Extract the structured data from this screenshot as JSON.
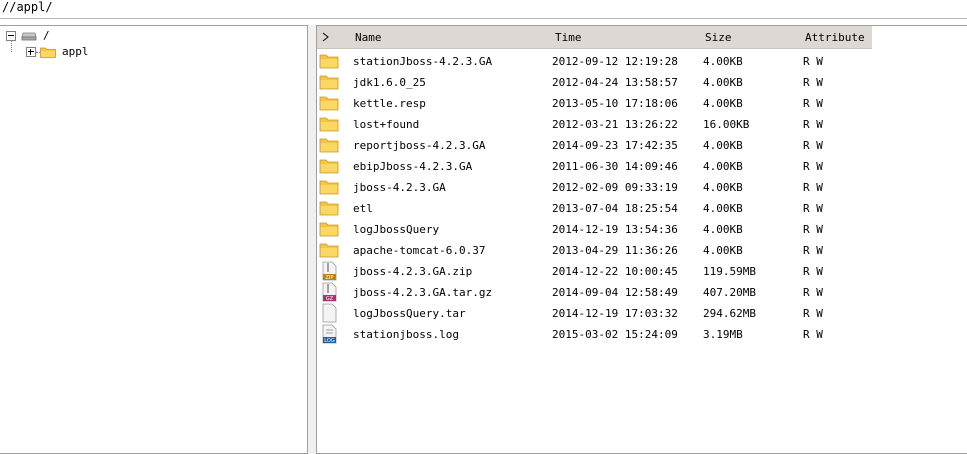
{
  "path": "//appl/",
  "tree": {
    "root_label": "/",
    "child_label": "appl"
  },
  "columns": {
    "name": "Name",
    "time": "Time",
    "size": "Size",
    "attribute": "Attribute"
  },
  "files": [
    {
      "name": "stationJboss-4.2.3.GA",
      "time": "2012-09-12 12:19:28",
      "size": "4.00KB",
      "attr": "R W",
      "icon": "folder-icon"
    },
    {
      "name": "jdk1.6.0_25",
      "time": "2012-04-24 13:58:57",
      "size": "4.00KB",
      "attr": "R W",
      "icon": "folder-icon"
    },
    {
      "name": "kettle.resp",
      "time": "2013-05-10 17:18:06",
      "size": "4.00KB",
      "attr": "R W",
      "icon": "folder-icon"
    },
    {
      "name": "lost+found",
      "time": "2012-03-21 13:26:22",
      "size": "16.00KB",
      "attr": "R W",
      "icon": "folder-icon"
    },
    {
      "name": "reportjboss-4.2.3.GA",
      "time": "2014-09-23 17:42:35",
      "size": "4.00KB",
      "attr": "R W",
      "icon": "folder-icon"
    },
    {
      "name": "ebipJboss-4.2.3.GA",
      "time": "2011-06-30 14:09:46",
      "size": "4.00KB",
      "attr": "R W",
      "icon": "folder-icon"
    },
    {
      "name": "jboss-4.2.3.GA",
      "time": "2012-02-09 09:33:19",
      "size": "4.00KB",
      "attr": "R W",
      "icon": "folder-icon"
    },
    {
      "name": "etl",
      "time": "2013-07-04 18:25:54",
      "size": "4.00KB",
      "attr": "R W",
      "icon": "folder-icon"
    },
    {
      "name": "logJbossQuery",
      "time": "2014-12-19 13:54:36",
      "size": "4.00KB",
      "attr": "R W",
      "icon": "folder-icon"
    },
    {
      "name": "apache-tomcat-6.0.37",
      "time": "2013-04-29 11:36:26",
      "size": "4.00KB",
      "attr": "R W",
      "icon": "folder-icon"
    },
    {
      "name": "jboss-4.2.3.GA.zip",
      "time": "2014-12-22 10:00:45",
      "size": "119.59MB",
      "attr": "R W",
      "icon": "zip-file-icon",
      "badge": "ZIP"
    },
    {
      "name": "jboss-4.2.3.GA.tar.gz",
      "time": "2014-09-04 12:58:49",
      "size": "407.20MB",
      "attr": "R W",
      "icon": "gz-file-icon",
      "badge": "GZ"
    },
    {
      "name": "logJbossQuery.tar",
      "time": "2014-12-19 17:03:32",
      "size": "294.62MB",
      "attr": "R W",
      "icon": "blank-file-icon"
    },
    {
      "name": "stationjboss.log",
      "time": "2015-03-02 15:24:09",
      "size": "3.19MB",
      "attr": "R W",
      "icon": "log-file-icon",
      "badge": "LOG"
    }
  ],
  "colors": {
    "header_bg": "#ddd8d3",
    "folder": "#f4c542",
    "zip_badge": "#b8860b",
    "gz_badge": "#b03070",
    "log_badge": "#2060a0"
  }
}
